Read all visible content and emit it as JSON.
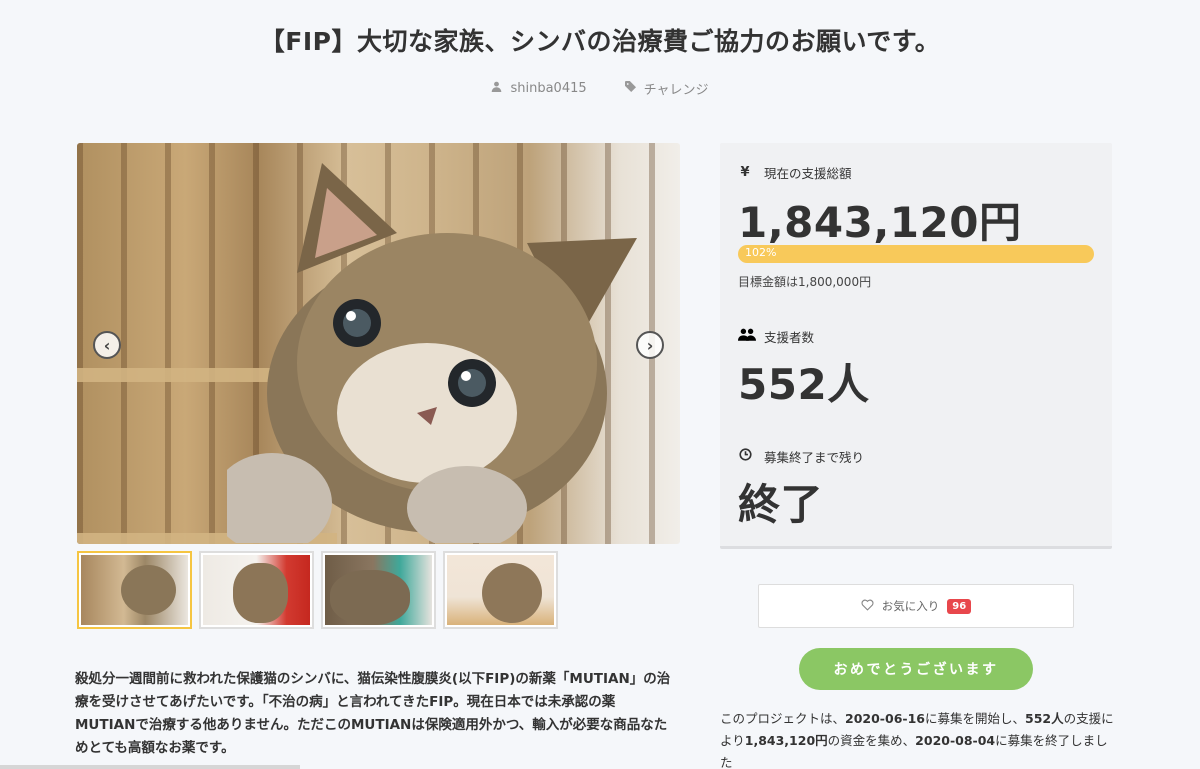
{
  "page": {
    "title": "【FIP】大切な家族、シンバの治療費ご協力のお願いです。",
    "author": "shinba0415",
    "category": "チャレンジ"
  },
  "gallery": {
    "thumbnail_count": 4,
    "active_index": 0
  },
  "description": {
    "text": "殺処分一週間前に救われた保護猫のシンバに、猫伝染性腹膜炎(以下FIP)の新薬「MUTIAN」の治療を受けさせてあげたいです。「不治の病」と言われてきたFIP。現在日本では未承認の薬MUTIANで治療する他ありません。ただこのMUTIANは保険適用外かつ、輸入が必要な商品なためとても高額なお薬です。"
  },
  "stats": {
    "total_label": "現在の支援総額",
    "total_value": "1,843,120円",
    "progress_label": "102%",
    "progress_fraction": 1.02,
    "goal_text": "目標金額は1,800,000円",
    "supporters_label": "支援者数",
    "supporters_value": "552人",
    "remaining_label": "募集終了まで残り",
    "remaining_value": "終了"
  },
  "favorite": {
    "label": "お気に入り",
    "count": "96"
  },
  "cta": {
    "label": "おめでとうございます"
  },
  "summary": {
    "p1": "このプロジェクトは、",
    "start_date": "2020-06-16",
    "p2": "に募集を開始し、",
    "supporters": "552人",
    "p3": "の支援に",
    "p4": "より",
    "amount": "1,843,120円",
    "p5": "の資金を集め、",
    "end_date": "2020-08-04",
    "p6": "に募集を終了しました"
  },
  "colors": {
    "progress": "#f8c95a",
    "cta": "#8bc764",
    "badge": "#e8474c",
    "active_thumb_border": "#f5c542"
  },
  "icons": {
    "author": "user-icon",
    "category": "tag-icon",
    "total": "yen-icon",
    "supporters": "users-icon",
    "remaining": "clock-icon",
    "favorite": "heart-icon",
    "prev": "chevron-left-icon",
    "next": "chevron-right-icon"
  }
}
